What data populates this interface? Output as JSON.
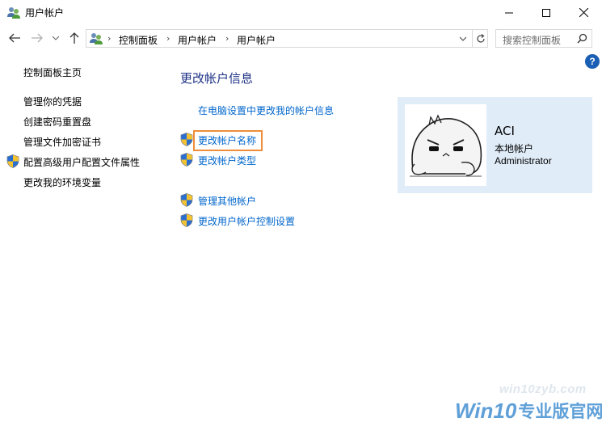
{
  "window": {
    "title": "用户帐户"
  },
  "address_bar": {
    "breadcrumbs": [
      "控制面板",
      "用户帐户",
      "用户帐户"
    ],
    "separator": "›"
  },
  "search": {
    "placeholder": "搜索控制面板"
  },
  "help": {
    "label": "?"
  },
  "left_nav": {
    "items": [
      "控制面板主页",
      "管理你的凭据",
      "创建密码重置盘",
      "管理文件加密证书",
      "配置高级用户配置文件属性",
      "更改我的环境变量"
    ]
  },
  "main": {
    "title": "更改帐户信息",
    "links": [
      "在电脑设置中更改我的帐户信息",
      "更改帐户名称",
      "更改帐户类型",
      "管理其他帐户",
      "更改用户帐户控制设置"
    ]
  },
  "account": {
    "name": "ACI",
    "type": "本地帐户",
    "role": "Administrator"
  },
  "watermark": {
    "url": "win10zyb.com",
    "brand_win": "Win10",
    "brand_cn": "专业版官网"
  },
  "colors": {
    "link": "#0066cc",
    "heading": "#1e3287",
    "highlight": "#ef8d3a",
    "card_bg": "#e0ecf8"
  }
}
